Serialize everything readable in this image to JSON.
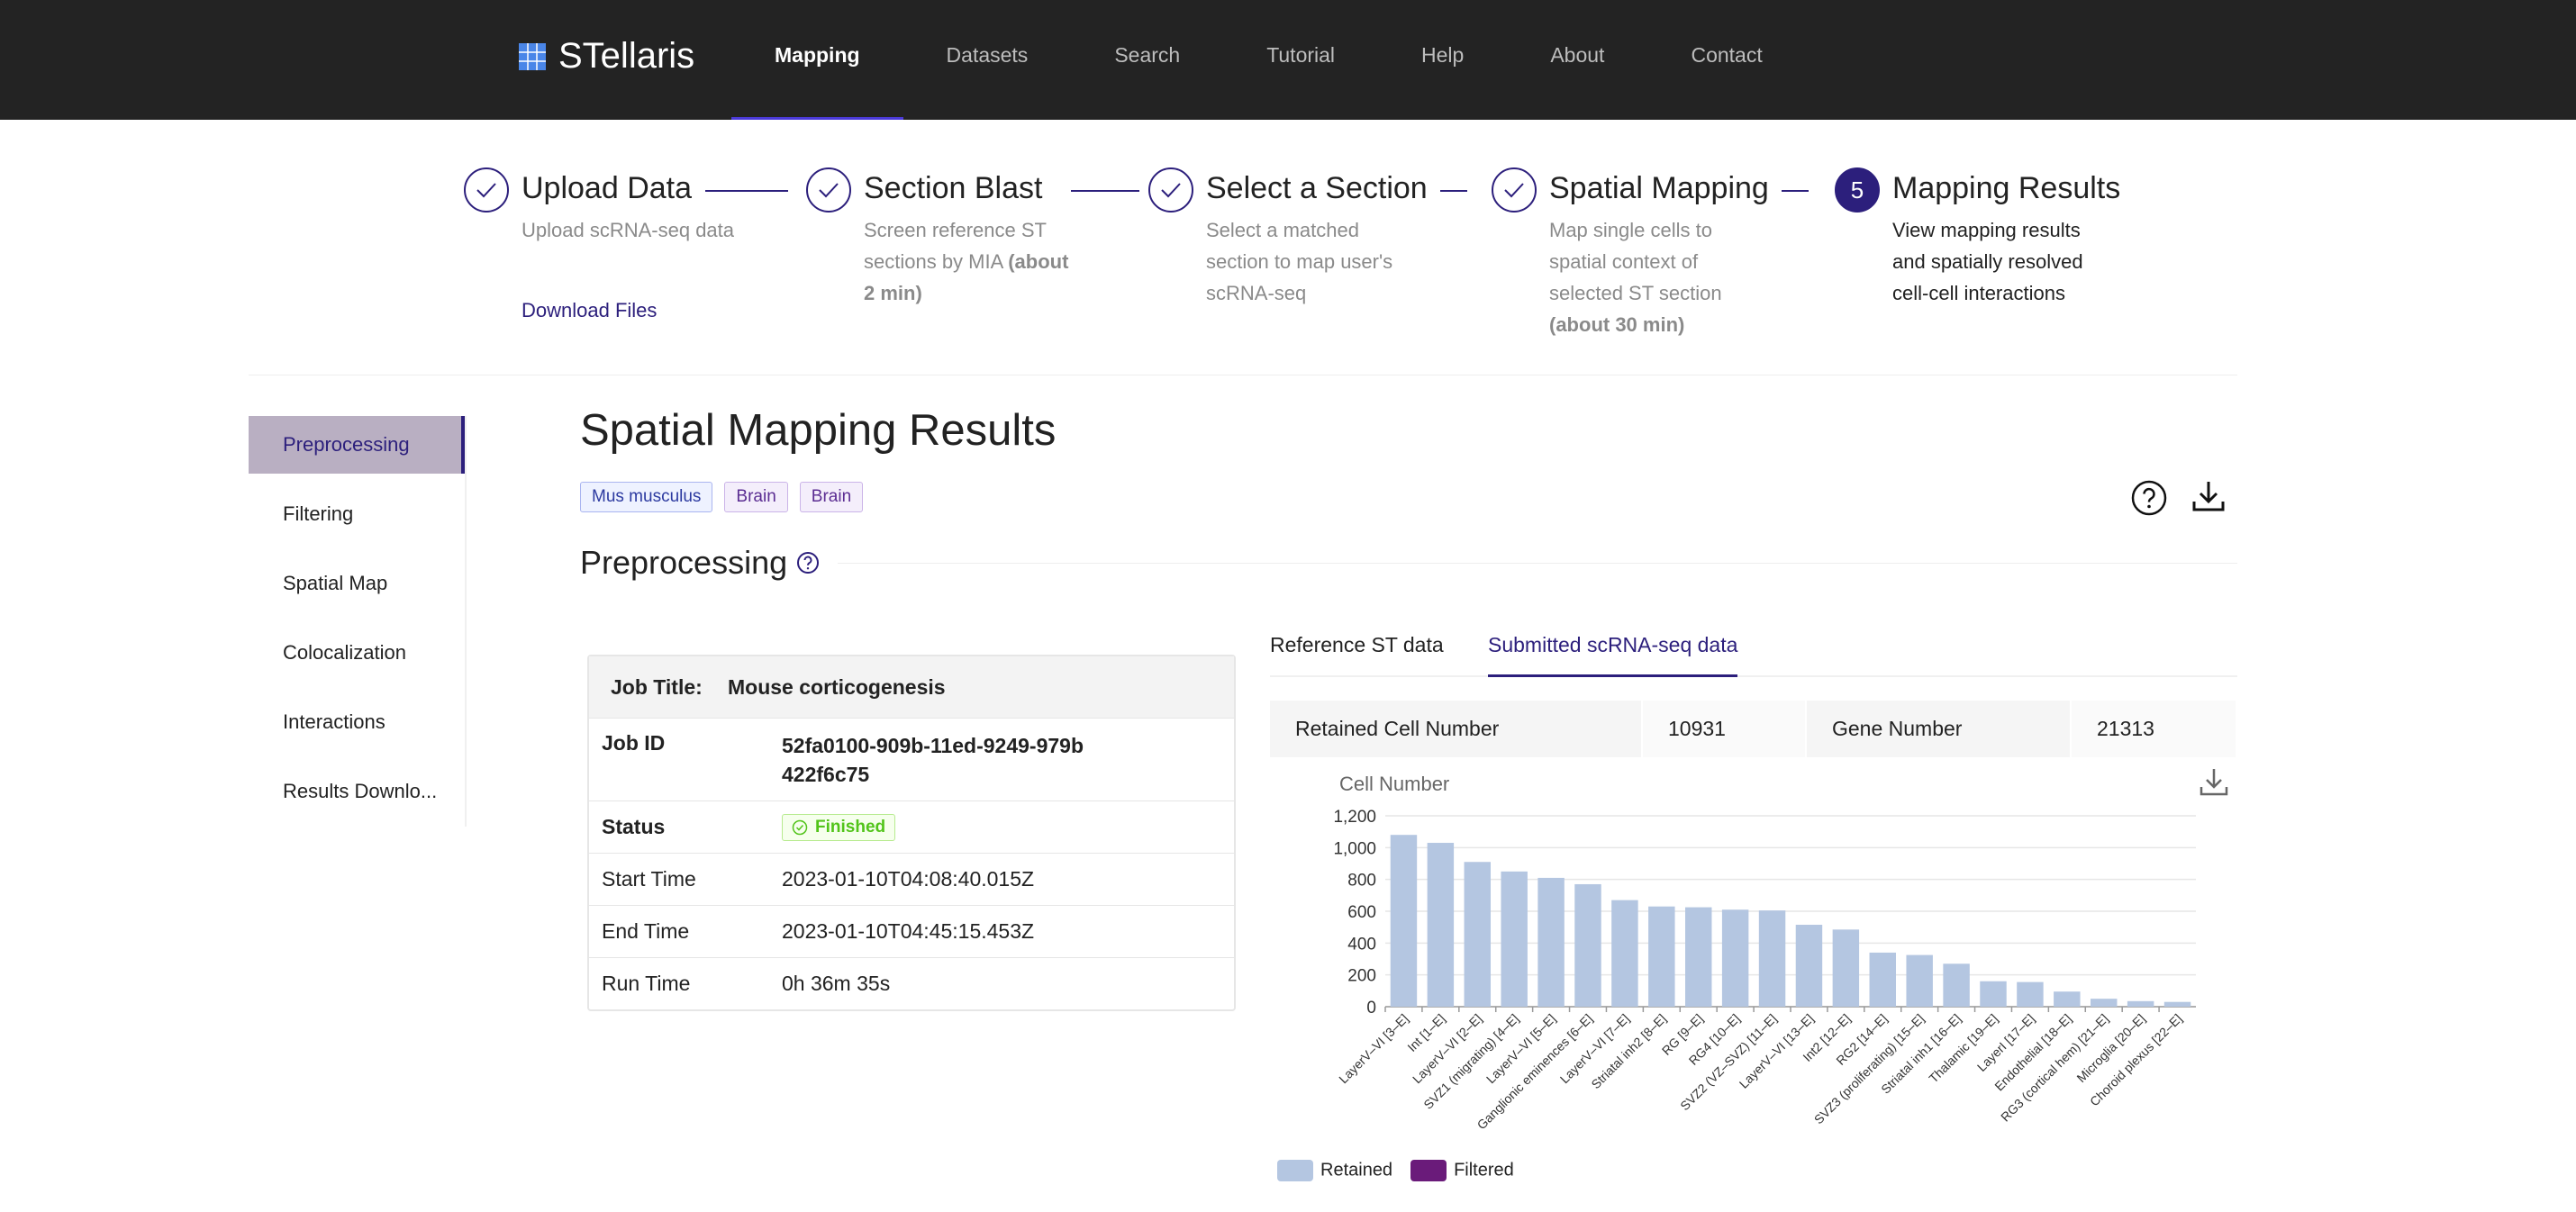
{
  "app": {
    "name": "STellaris"
  },
  "nav": {
    "items": [
      "Mapping",
      "Datasets",
      "Search",
      "Tutorial",
      "Help",
      "About",
      "Contact"
    ],
    "active": "Mapping"
  },
  "steps": [
    {
      "num": "1",
      "title": "Upload Data",
      "desc": "Upload scRNA-seq data",
      "note": "",
      "status": "done"
    },
    {
      "num": "2",
      "title": "Section Blast",
      "desc": "Screen reference ST sections by MIA",
      "note": "(about 2 min)",
      "status": "done"
    },
    {
      "num": "3",
      "title": "Select a Section",
      "desc": "Select a matched section to map user's scRNA-seq",
      "note": "",
      "status": "done"
    },
    {
      "num": "4",
      "title": "Spatial Mapping",
      "desc": "Map single cells to spatial context of selected ST section",
      "note": "(about 30 min)",
      "status": "done"
    },
    {
      "num": "5",
      "title": "Mapping Results",
      "desc": "View mapping results and spatially resolved cell-cell interactions",
      "note": "",
      "status": "current"
    }
  ],
  "download_files": "Download Files",
  "sidebar": {
    "items": [
      "Preprocessing",
      "Filtering",
      "Spatial Map",
      "Colocalization",
      "Interactions",
      "Results Downlo..."
    ],
    "active": "Preprocessing"
  },
  "page": {
    "title": "Spatial Mapping Results",
    "tags": [
      "Mus musculus",
      "Brain",
      "Brain"
    ]
  },
  "section": {
    "title": "Preprocessing"
  },
  "job": {
    "title_label": "Job Title:",
    "title_value": "Mouse corticogenesis",
    "id_label": "Job ID",
    "id_value": "52fa0100-909b-11ed-9249-979b422f6c75",
    "status_label": "Status",
    "status_value": "Finished",
    "start_label": "Start Time",
    "start_value": "2023-01-10T04:08:40.015Z",
    "end_label": "End Time",
    "end_value": "2023-01-10T04:45:15.453Z",
    "run_label": "Run Time",
    "run_value": "0h 36m 35s"
  },
  "tabs": [
    "Reference ST data",
    "Submitted scRNA-seq data"
  ],
  "active_tab": "Submitted scRNA-seq data",
  "stats": {
    "retained_label": "Retained Cell Number",
    "retained_value": "10931",
    "gene_label": "Gene Number",
    "gene_value": "21313"
  },
  "colors": {
    "accent": "#2c1f7c",
    "retained": "#b4c6e1",
    "filtered": "#6a1b7a",
    "topbar": "#232323"
  },
  "chart_data": {
    "type": "bar",
    "ylabel": "Cell Number",
    "ylim": [
      0,
      1200
    ],
    "yticks": [
      "0",
      "200",
      "400",
      "600",
      "800",
      "1,000",
      "1,200"
    ],
    "categories": [
      "LayerV–VI [3–E]",
      "Int [1–E]",
      "LayerV–VI [2–E]",
      "SVZ1 (migrating) [4–E]",
      "LayerV–VI [5–E]",
      "Ganglionic eminences [6–E]",
      "LayerV–VI [7–E]",
      "Striatal inh2 [8–E]",
      "RG [9–E]",
      "RG4 [10–E]",
      "SVZ2 (VZ–SVZ) [11–E]",
      "LayerV–VI [13–E]",
      "Int2 [12–E]",
      "RG2 [14–E]",
      "SVZ3 (proliferating) [15–E]",
      "Striatal inh1 [16–E]",
      "Thalamic [19–E]",
      "LayerI [17–E]",
      "Endothelial [18–E]",
      "RG3 (cortical hem) [21–E]",
      "Microglia [20–E]",
      "Choroid plexus [22–E]"
    ],
    "series": [
      {
        "name": "Retained",
        "values": [
          1080,
          1030,
          910,
          850,
          810,
          770,
          670,
          630,
          625,
          610,
          605,
          515,
          485,
          340,
          325,
          270,
          160,
          155,
          95,
          50,
          35,
          30
        ]
      },
      {
        "name": "Filtered",
        "values": [
          0,
          0,
          0,
          0,
          0,
          0,
          0,
          0,
          0,
          0,
          0,
          0,
          0,
          0,
          0,
          0,
          0,
          0,
          0,
          0,
          0,
          0
        ]
      }
    ],
    "legend": "bottom-left",
    "grid": true
  }
}
